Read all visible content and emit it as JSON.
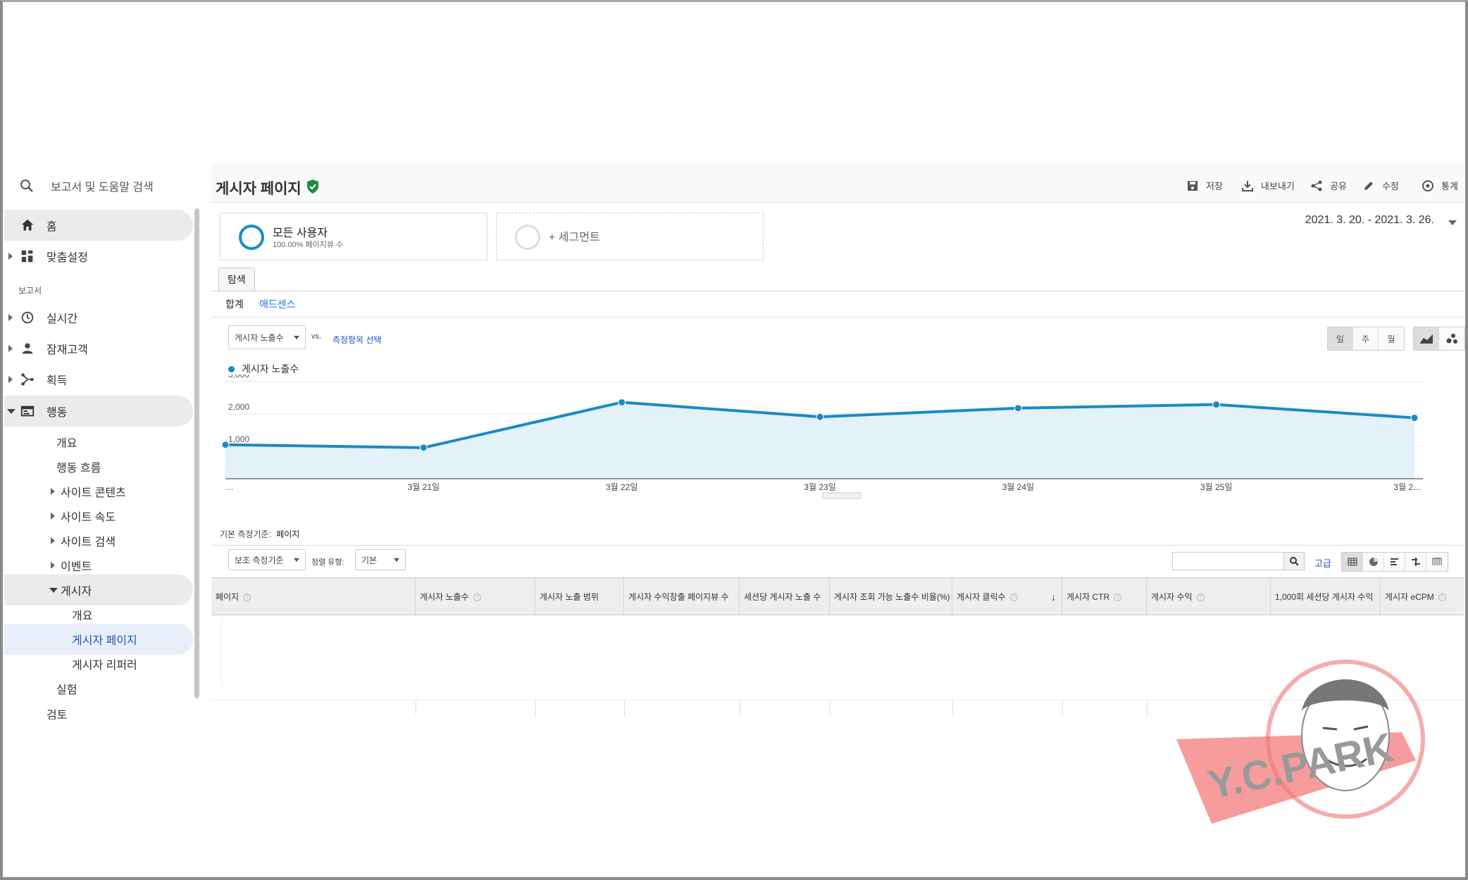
{
  "sidebar": {
    "search_placeholder": "보고서 및 도움말 검색",
    "items": [
      {
        "label": "홈"
      },
      {
        "label": "맞춤설정"
      },
      {
        "label": "실시간"
      },
      {
        "label": "잠재고객"
      },
      {
        "label": "획득"
      },
      {
        "label": "행동"
      }
    ],
    "section_reports": "보고서",
    "behavior_children": [
      "개요",
      "행동 흐름",
      "사이트 콘텐츠",
      "사이트 속도",
      "사이트 검색",
      "이벤트",
      "게시자"
    ],
    "publisher_children": [
      "개요",
      "게시자 페이지",
      "게시자 리퍼러"
    ],
    "experiments": "실험",
    "bottom_cut": "검토"
  },
  "header": {
    "title": "게시자 페이지",
    "actions": [
      "저장",
      "내보내기",
      "공유",
      "수정",
      "통계"
    ]
  },
  "segments": {
    "all_users": "모든 사용자",
    "all_users_sub": "100.00% 페이지뷰 수",
    "add_segment": "+ 세그먼트"
  },
  "date_range": "2021. 3. 20. - 2021. 3. 26.",
  "tabs": {
    "explore": "탐색",
    "summary": "합계",
    "adsense": "애드센스"
  },
  "chart_controls": {
    "metric": "게시자 노출수",
    "vs": "vs.",
    "select_metric": "측정항목 선택",
    "granularity": [
      "일",
      "주",
      "월"
    ]
  },
  "chart_data": {
    "type": "area",
    "series": [
      {
        "name": "게시자 노출수",
        "values": [
          1050,
          960,
          2360,
          1910,
          2180,
          2290,
          1880
        ]
      }
    ],
    "x": [
      "…",
      "3월 21일",
      "3월 22일",
      "3월 23일",
      "3월 24일",
      "3월 25일",
      "3월 2…"
    ],
    "yticks": [
      "3,000",
      "2,000",
      "1,000"
    ],
    "ylim": [
      0,
      3000
    ],
    "color": "#1a8ac5",
    "fill": "#e3f1f9"
  },
  "table": {
    "primary_dimension_label": "기본 측정기준:",
    "primary_dimension_value": "페이지",
    "secondary_dim": "보조 측정기준",
    "sort_type_label": "정렬 유형:",
    "sort_type": "기본",
    "advanced": "고급",
    "columns": [
      "페이지",
      "게시자 노출수",
      "게시자 노출 범위",
      "게시자 수익창출 페이지뷰 수",
      "세션당 게시자 노출 수",
      "게시자 조회 가능 노출수 비율(%)",
      "게시자 클릭수",
      "게시자 CTR",
      "게시자 수익",
      "1,000회 세션당 게시자 수익",
      "게시자 eCPM"
    ]
  },
  "watermark": "Y.C.PARK"
}
